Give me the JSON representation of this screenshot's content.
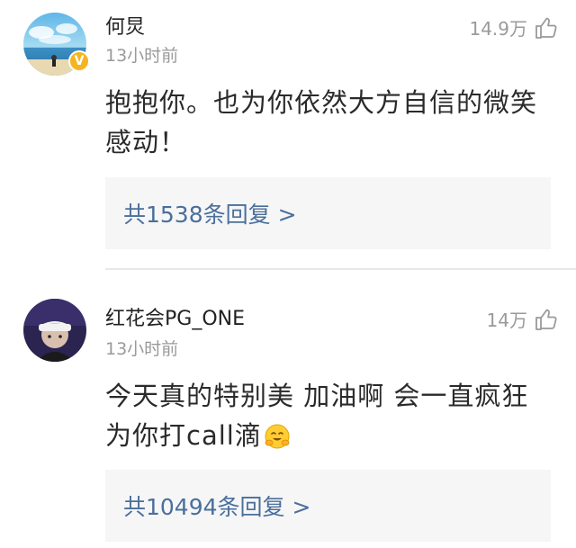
{
  "comments": [
    {
      "username": "何炅",
      "time": "13小时前",
      "likes": "14.9万",
      "verified": true,
      "text": "抱抱你。也为你依然大方自信的微笑感动！",
      "replies": "共1538条回复 >"
    },
    {
      "username": "红花会PG_ONE",
      "time": "13小时前",
      "likes": "14万",
      "verified": false,
      "text_line1": "今天真的特别美 加油啊 会一直疯狂",
      "text_line2": "为你打call滴",
      "replies": "共10494条回复 >"
    }
  ],
  "colors": {
    "link": "#4a6f9c",
    "secondary": "#9a9a9a",
    "verified_badge": "#f5b520",
    "reply_bg": "#f6f6f6"
  },
  "icons": {
    "like": "thumbs-up-icon",
    "verified": "verified-v-icon",
    "emoji": "hugging-face-emoji-icon"
  }
}
